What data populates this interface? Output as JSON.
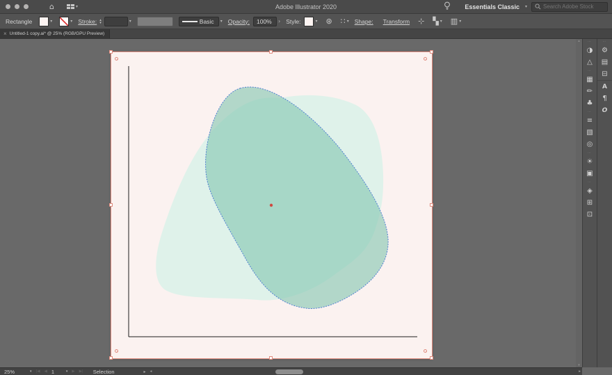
{
  "colors": {
    "titlebar-bg": "#4a4a4a",
    "controlbar-bg": "#535353",
    "tabstrip-bg": "#454545",
    "tab-bg": "#373737",
    "canvas-bg": "#696969",
    "panel-bg": "#525252",
    "statusbar-bg": "#434343",
    "artboard-bg": "#fbf2f0",
    "selection": "#e08b7e"
  },
  "glyphs": {
    "chevron_down": "▾",
    "chevron_up": "▴",
    "chevron_right": "›",
    "nav_first": "|◀",
    "nav_prev": "◀",
    "nav_next": "▶",
    "nav_last": "▶|",
    "menu_arrow": "▸",
    "scroll_left": "◂",
    "scroll_right": "▸",
    "scroll_up": "▴",
    "scroll_down": "▾",
    "grip_dots": "⋯",
    "home": "⌂"
  },
  "titlebar": {
    "title": "Adobe Illustrator 2020",
    "workspace_button": "Essentials Classic",
    "search_placeholder": "Search Adobe Stock"
  },
  "controlbar": {
    "tool_label": "Rectangle",
    "stroke_label": "Stroke:",
    "brush_name": "Basic",
    "opacity_label": "Opacity:",
    "opacity_value": "100%",
    "style_label": "Style:",
    "shape_label": "Shape:",
    "transform_label": "Transform",
    "recolor_glyph": "⊛",
    "pixel_grid_glyph": "∷",
    "isolate_glyph": "⊹",
    "select_similar_glyph": "▚",
    "align_glyph": "▥"
  },
  "tabbar": {
    "close_glyph": "×",
    "tab_title": "Untitled-1 copy.ai* @ 25% (RGB/GPU Preview)"
  },
  "canvas_art": {
    "artboard_fill": "#fbf2f0",
    "axis_color": "#1c1c1c",
    "blob_back_fill": "#dff2ea",
    "blob_front_fill": "#84c7b1",
    "blob_front_opacity": "0.62",
    "path_outline_color": "#4f7ed2",
    "anchor_color": "#cf4a41"
  },
  "dock": {
    "col1": [
      {
        "name": "color",
        "glyph": "◑"
      },
      {
        "name": "color-guide",
        "glyph": "△"
      },
      {
        "name": "swatches",
        "glyph": "▦"
      },
      {
        "name": "brushes",
        "glyph": "✏"
      },
      {
        "name": "symbols",
        "glyph": "♣"
      },
      {
        "name": "stroke",
        "glyph": "≡"
      },
      {
        "name": "gradient",
        "glyph": "▧"
      },
      {
        "name": "transparency",
        "glyph": "◎"
      },
      {
        "name": "appearance",
        "glyph": "☀"
      },
      {
        "name": "graphic-styles",
        "glyph": "▣"
      },
      {
        "name": "layers",
        "glyph": "◈"
      },
      {
        "name": "artboards",
        "glyph": "⊞"
      },
      {
        "name": "asset-export",
        "glyph": "⊡"
      }
    ],
    "col2": [
      {
        "name": "properties",
        "glyph": "⚙"
      },
      {
        "name": "libraries",
        "glyph": "▤"
      },
      {
        "name": "artboards-alt",
        "glyph": "⊟"
      },
      {
        "name": "character",
        "glyph": "A"
      },
      {
        "name": "paragraph",
        "glyph": "¶"
      },
      {
        "name": "opentype",
        "glyph": "O"
      }
    ]
  },
  "statusbar": {
    "zoom_value": "25%",
    "artboard_number": "1",
    "status_text": "Selection"
  }
}
